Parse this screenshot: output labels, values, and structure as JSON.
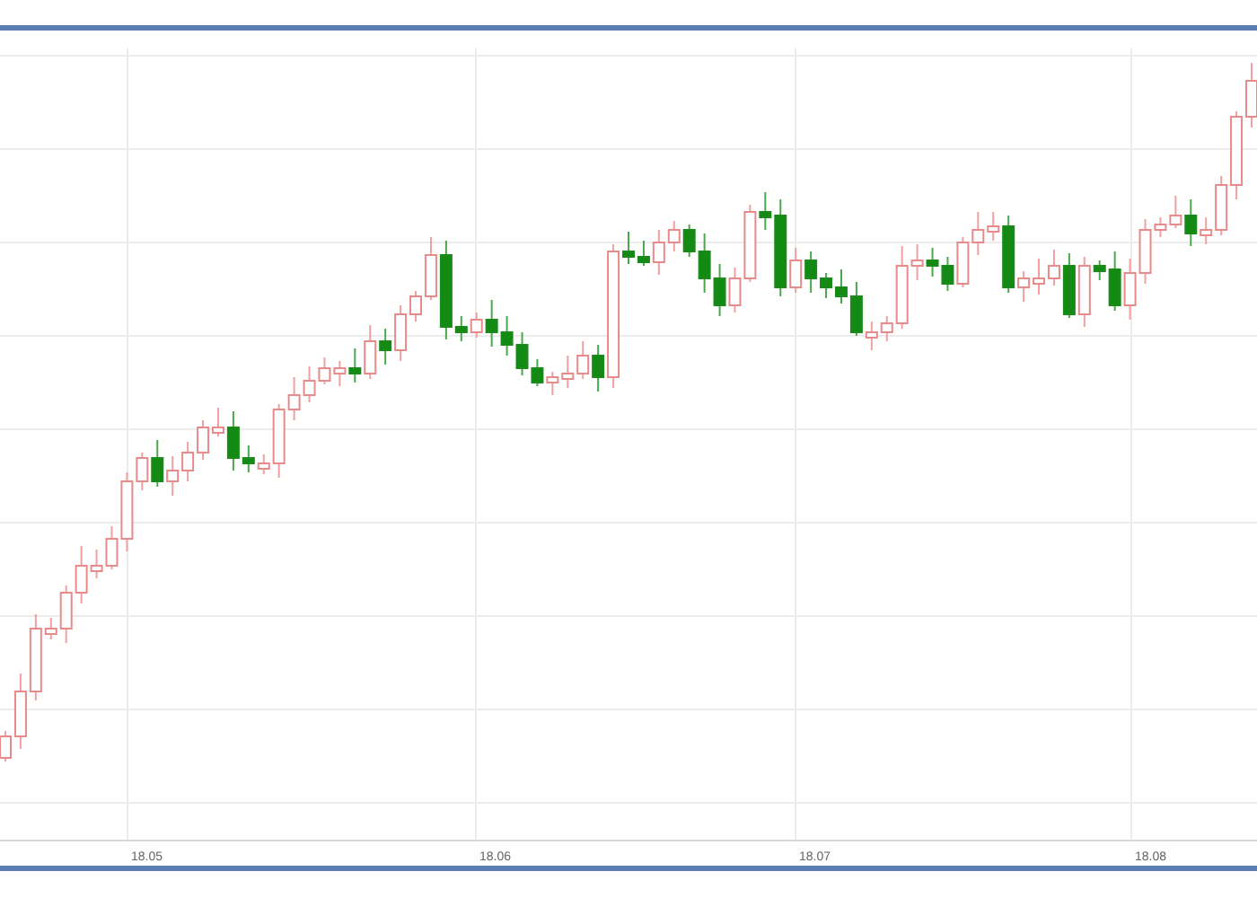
{
  "chart": {
    "x_axis_labels": [
      "18.05",
      "18.06",
      "18.07",
      "18.08"
    ]
  }
}
